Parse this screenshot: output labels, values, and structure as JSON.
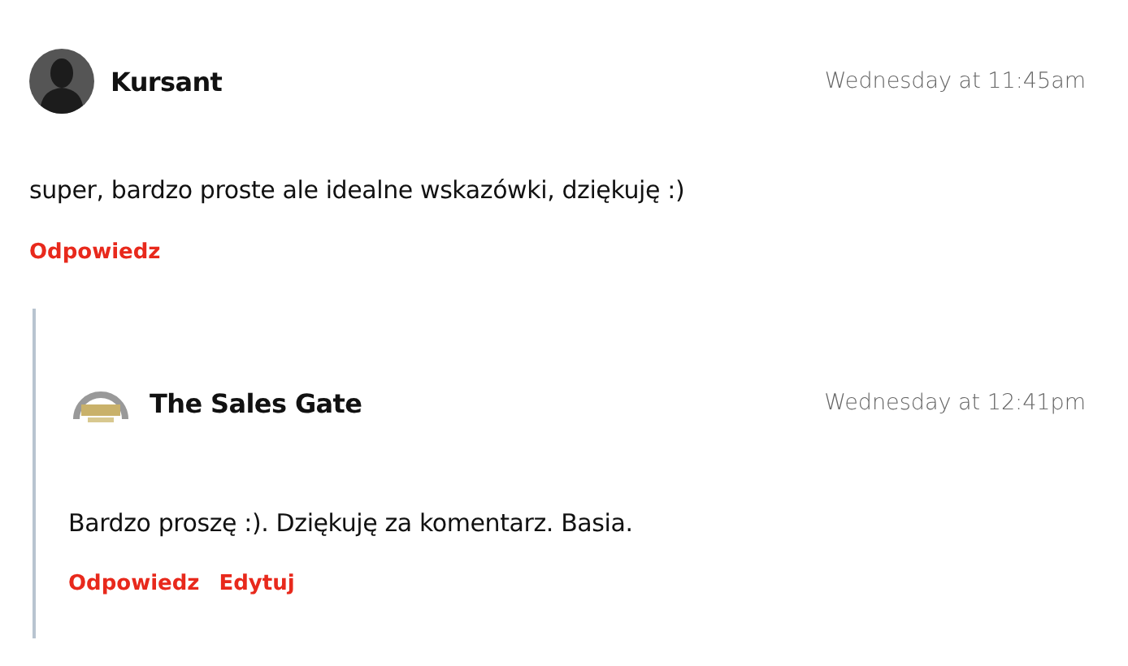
{
  "comments": [
    {
      "author": "Kursant",
      "avatar": {
        "kind": "silhouette"
      },
      "time": "Wednesday at 11:45am",
      "text": "super, bardzo proste ale idealne wskazówki, dziękuję :)",
      "actions": [
        "Odpowiedz"
      ],
      "children": [
        {
          "author": "The Sales Gate",
          "avatar": {
            "kind": "logo"
          },
          "time": "Wednesday at 12:41pm",
          "text": "Bardzo proszę :). Dziękuję za komentarz. Basia.",
          "actions": [
            "Odpowiedz",
            "Edytuj"
          ]
        }
      ]
    }
  ]
}
